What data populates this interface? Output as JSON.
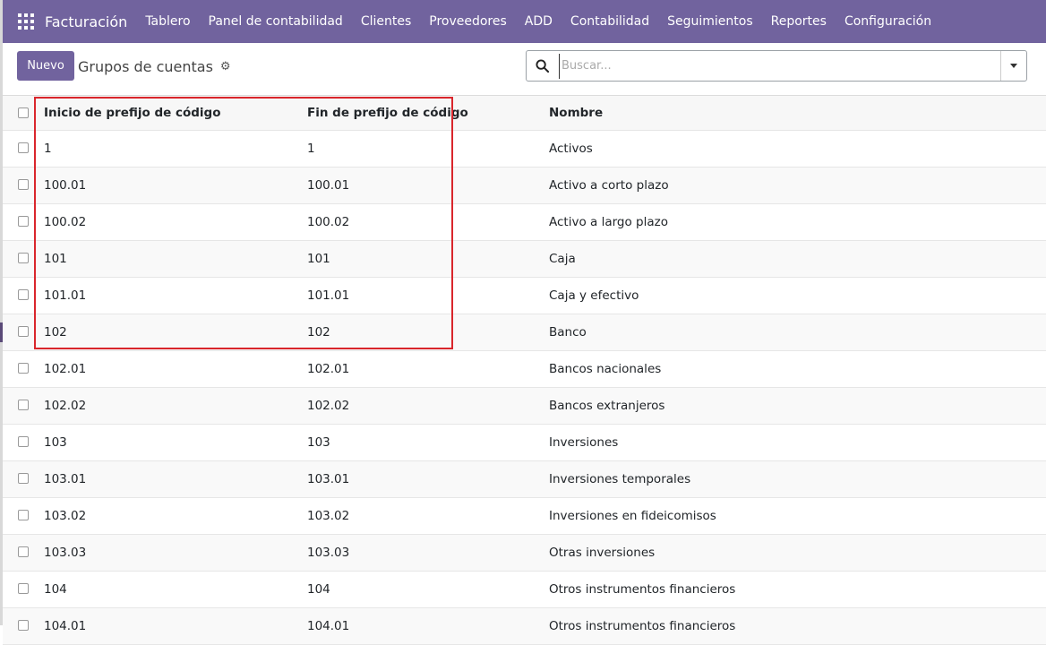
{
  "navbar": {
    "brand": "Facturación",
    "menu": [
      "Tablero",
      "Panel de contabilidad",
      "Clientes",
      "Proveedores",
      "ADD",
      "Contabilidad",
      "Seguimientos",
      "Reportes",
      "Configuración"
    ]
  },
  "control": {
    "new_label": "Nuevo",
    "breadcrumb": "Grupos de cuentas",
    "search_placeholder": "Buscar..."
  },
  "table": {
    "columns": [
      "Inicio de prefijo de código",
      "Fin de prefijo de código",
      "Nombre"
    ],
    "rows": [
      [
        "1",
        "1",
        "Activos"
      ],
      [
        "100.01",
        "100.01",
        "Activo a corto plazo"
      ],
      [
        "100.02",
        "100.02",
        "Activo a largo plazo"
      ],
      [
        "101",
        "101",
        "Caja"
      ],
      [
        "101.01",
        "101.01",
        "Caja y efectivo"
      ],
      [
        "102",
        "102",
        "Banco"
      ],
      [
        "102.01",
        "102.01",
        "Bancos nacionales"
      ],
      [
        "102.02",
        "102.02",
        "Bancos extranjeros"
      ],
      [
        "103",
        "103",
        "Inversiones"
      ],
      [
        "103.01",
        "103.01",
        "Inversiones temporales"
      ],
      [
        "103.02",
        "103.02",
        "Inversiones en fideicomisos"
      ],
      [
        "103.03",
        "103.03",
        "Otras inversiones"
      ],
      [
        "104",
        "104",
        "Otros instrumentos financieros"
      ],
      [
        "104.01",
        "104.01",
        "Otros instrumentos financieros"
      ]
    ]
  },
  "colors": {
    "navbar": "#71639e",
    "highlight": "#d9262c"
  }
}
